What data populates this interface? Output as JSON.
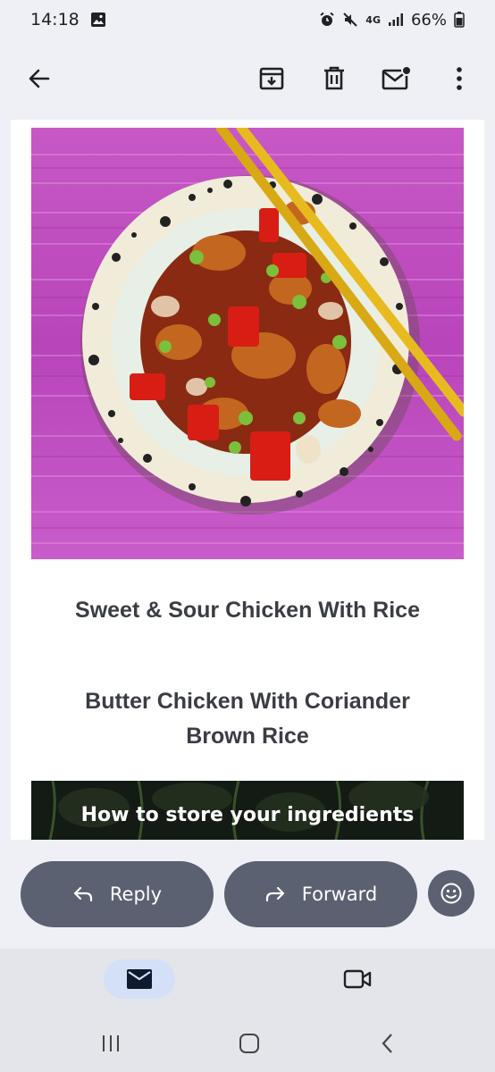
{
  "status_bar": {
    "time": "14:18",
    "network": "4G",
    "battery": "66%"
  },
  "app_bar": {
    "icons": [
      "back-arrow-icon",
      "archive-icon",
      "delete-icon",
      "mark-unread-icon",
      "more-vert-icon"
    ]
  },
  "email": {
    "hero_image": "sweet-and-sour-chicken-bowl",
    "recipes": [
      {
        "title": "Sweet & Sour Chicken With Rice"
      },
      {
        "title": "Butter Chicken With Coriander\nBrown Rice"
      }
    ],
    "banner_text": "How to store your ingredients"
  },
  "actions": {
    "reply_label": "Reply",
    "forward_label": "Forward"
  },
  "colors": {
    "action_pill": "#5b6170",
    "nav_active": "#d4e0f7",
    "hero_background": "#c24bc6"
  }
}
